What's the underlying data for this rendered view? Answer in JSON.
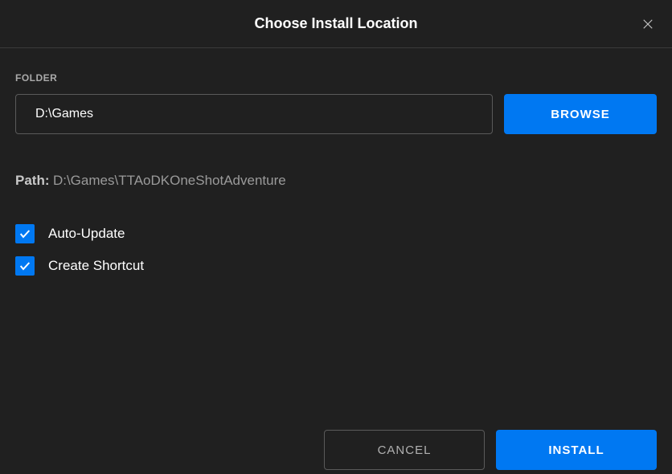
{
  "header": {
    "title": "Choose Install Location"
  },
  "folder": {
    "label": "FOLDER",
    "value": "D:\\Games",
    "browse_label": "BROWSE"
  },
  "path": {
    "label": "Path:",
    "value": "D:\\Games\\TTAoDKOneShotAdventure"
  },
  "options": {
    "auto_update": {
      "label": "Auto-Update",
      "checked": true
    },
    "create_shortcut": {
      "label": "Create Shortcut",
      "checked": true
    }
  },
  "footer": {
    "cancel_label": "CANCEL",
    "install_label": "INSTALL"
  }
}
